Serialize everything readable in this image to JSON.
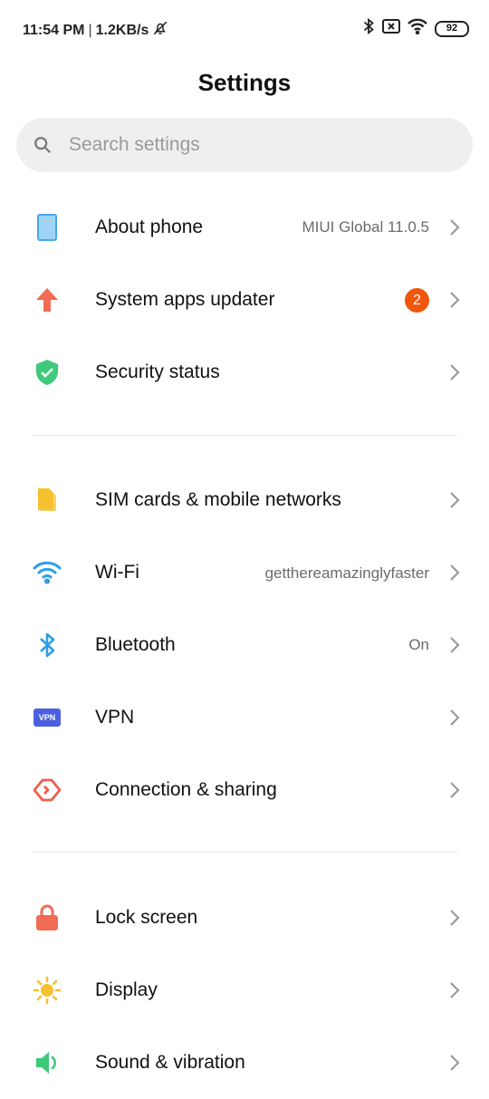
{
  "status_bar": {
    "time": "11:54 PM",
    "separator": "|",
    "speed": "1.2KB/s",
    "battery": "92",
    "icons": [
      "bell-off-icon",
      "bluetooth-icon",
      "sim-x-icon",
      "wifi-icon",
      "battery-icon"
    ]
  },
  "header": {
    "title": "Settings"
  },
  "search": {
    "placeholder": "Search settings"
  },
  "groups": [
    [
      {
        "label": "About phone",
        "value": "MIUI Global 11.0.5",
        "icon": "phone-icon",
        "color": "#4aa8e8"
      },
      {
        "label": "System apps updater",
        "badge": "2",
        "icon": "arrow-up-icon",
        "color": "#f26b55"
      },
      {
        "label": "Security status",
        "icon": "shield-check-icon",
        "color": "#3ec97b"
      }
    ],
    [
      {
        "label": "SIM cards & mobile networks",
        "icon": "sim-card-icon",
        "color": "#f5c12e"
      },
      {
        "label": "Wi-Fi",
        "value": "getthereamazinglyfaster",
        "icon": "wifi-icon",
        "color": "#2f9ee8"
      },
      {
        "label": "Bluetooth",
        "value": "On",
        "icon": "bluetooth-icon",
        "color": "#2f9ee8"
      },
      {
        "label": "VPN",
        "icon": "vpn-icon",
        "icon_text": "VPN",
        "color": "#4b5fe0"
      },
      {
        "label": "Connection & sharing",
        "icon": "connection-sharing-icon",
        "color": "#ef5e4c"
      }
    ],
    [
      {
        "label": "Lock screen",
        "icon": "lock-icon",
        "color": "#f26b55"
      },
      {
        "label": "Display",
        "icon": "sun-icon",
        "color": "#f5c12e"
      },
      {
        "label": "Sound & vibration",
        "icon": "speaker-icon",
        "color": "#3ec97b"
      }
    ]
  ]
}
